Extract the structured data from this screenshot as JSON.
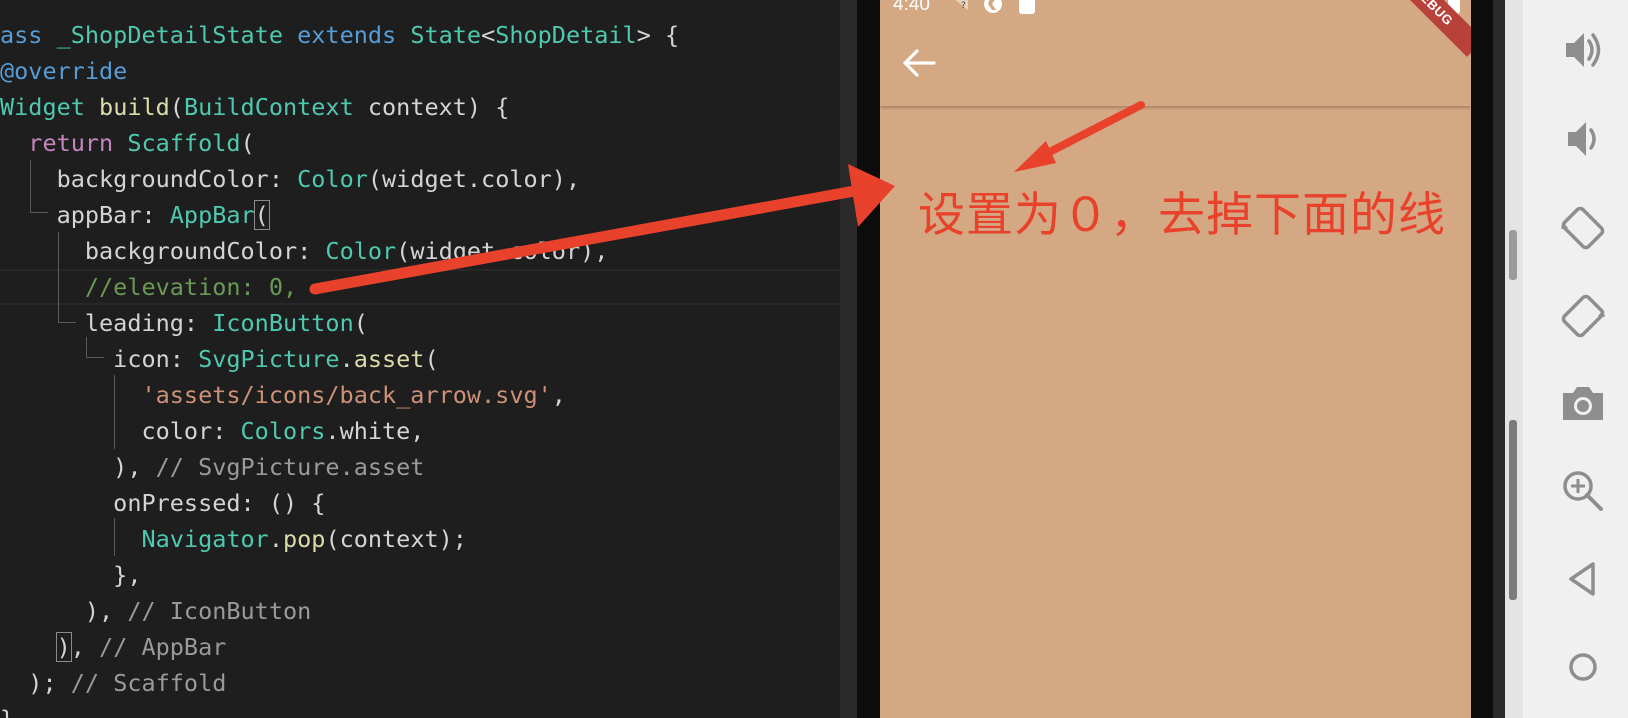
{
  "editor": {
    "lines": [
      [
        {
          "t": "ass ",
          "c": "tok-kw"
        },
        {
          "t": "_ShopDetailState ",
          "c": "tok-type"
        },
        {
          "t": "extends ",
          "c": "tok-kw"
        },
        {
          "t": "State",
          "c": "tok-type"
        },
        {
          "t": "<",
          "c": "tok-p"
        },
        {
          "t": "ShopDetail",
          "c": "tok-type"
        },
        {
          "t": "> {",
          "c": "tok-p"
        }
      ],
      [
        {
          "t": "@override",
          "c": "tok-ann"
        }
      ],
      [
        {
          "t": "Widget ",
          "c": "tok-type"
        },
        {
          "t": "build",
          "c": "tok-fn"
        },
        {
          "t": "(",
          "c": "tok-p"
        },
        {
          "t": "BuildContext ",
          "c": "tok-type"
        },
        {
          "t": "context) {",
          "c": "tok-p"
        }
      ],
      [
        {
          "t": "  return ",
          "c": "tok-kw2"
        },
        {
          "t": "Scaffold",
          "c": "tok-type"
        },
        {
          "t": "(",
          "c": "tok-p"
        }
      ],
      [
        {
          "t": "    backgroundColor: ",
          "c": "tok-p"
        },
        {
          "t": "Color",
          "c": "tok-type"
        },
        {
          "t": "(widget.color),",
          "c": "tok-p"
        }
      ],
      [
        {
          "t": "    appBar: ",
          "c": "tok-p"
        },
        {
          "t": "AppBar",
          "c": "tok-type"
        },
        {
          "t": "(",
          "c": "tok-p bracket-box"
        }
      ],
      [
        {
          "t": "      backgroundColor: ",
          "c": "tok-p"
        },
        {
          "t": "Color",
          "c": "tok-type"
        },
        {
          "t": "(widget.color),",
          "c": "tok-p"
        }
      ],
      [
        {
          "t": "      //elevation: 0,",
          "c": "tok-cm"
        }
      ],
      [
        {
          "t": "      leading: ",
          "c": "tok-p"
        },
        {
          "t": "IconButton",
          "c": "tok-type"
        },
        {
          "t": "(",
          "c": "tok-p"
        }
      ],
      [
        {
          "t": "        icon: ",
          "c": "tok-p"
        },
        {
          "t": "SvgPicture",
          "c": "tok-type"
        },
        {
          "t": ".",
          "c": "tok-p"
        },
        {
          "t": "asset",
          "c": "tok-fn"
        },
        {
          "t": "(",
          "c": "tok-p"
        }
      ],
      [
        {
          "t": "          'assets/icons/back_arrow.svg'",
          "c": "tok-str"
        },
        {
          "t": ",",
          "c": "tok-p"
        }
      ],
      [
        {
          "t": "          color: ",
          "c": "tok-p"
        },
        {
          "t": "Colors",
          "c": "tok-type"
        },
        {
          "t": ".white,",
          "c": "tok-p"
        }
      ],
      [
        {
          "t": "        ), ",
          "c": "tok-p"
        },
        {
          "t": "// SvgPicture.asset",
          "c": "tok-cm2"
        }
      ],
      [
        {
          "t": "        onPressed: () {",
          "c": "tok-p"
        }
      ],
      [
        {
          "t": "          ",
          "c": "tok-p"
        },
        {
          "t": "Navigator",
          "c": "tok-type"
        },
        {
          "t": ".",
          "c": "tok-p"
        },
        {
          "t": "pop",
          "c": "tok-fn"
        },
        {
          "t": "(context);",
          "c": "tok-p"
        }
      ],
      [
        {
          "t": "        },",
          "c": "tok-p"
        }
      ],
      [
        {
          "t": "      ), ",
          "c": "tok-p"
        },
        {
          "t": "// IconButton",
          "c": "tok-cm2"
        }
      ],
      [
        {
          "t": "    ",
          "c": "tok-p"
        },
        {
          "t": ")",
          "c": "tok-p bracket-box"
        },
        {
          "t": ", ",
          "c": "tok-p"
        },
        {
          "t": "// AppBar",
          "c": "tok-cm2"
        }
      ],
      [
        {
          "t": "  ); ",
          "c": "tok-p"
        },
        {
          "t": "// Scaffold",
          "c": "tok-cm2"
        }
      ],
      [
        {
          "t": "}",
          "c": "tok-p"
        }
      ]
    ]
  },
  "phone": {
    "status_time": "4:40",
    "debug_label": "DEBUG",
    "screen_color": "#d4a882"
  },
  "annotation": {
    "text": "设置为０，去掉下面的线",
    "color": "#e8412c"
  },
  "toolbar": {
    "items": [
      "volume-up-icon",
      "volume-down-icon",
      "rotate-left-icon",
      "rotate-right-icon",
      "camera-icon",
      "zoom-in-icon",
      "back-triangle-icon",
      "home-circle-icon"
    ]
  }
}
